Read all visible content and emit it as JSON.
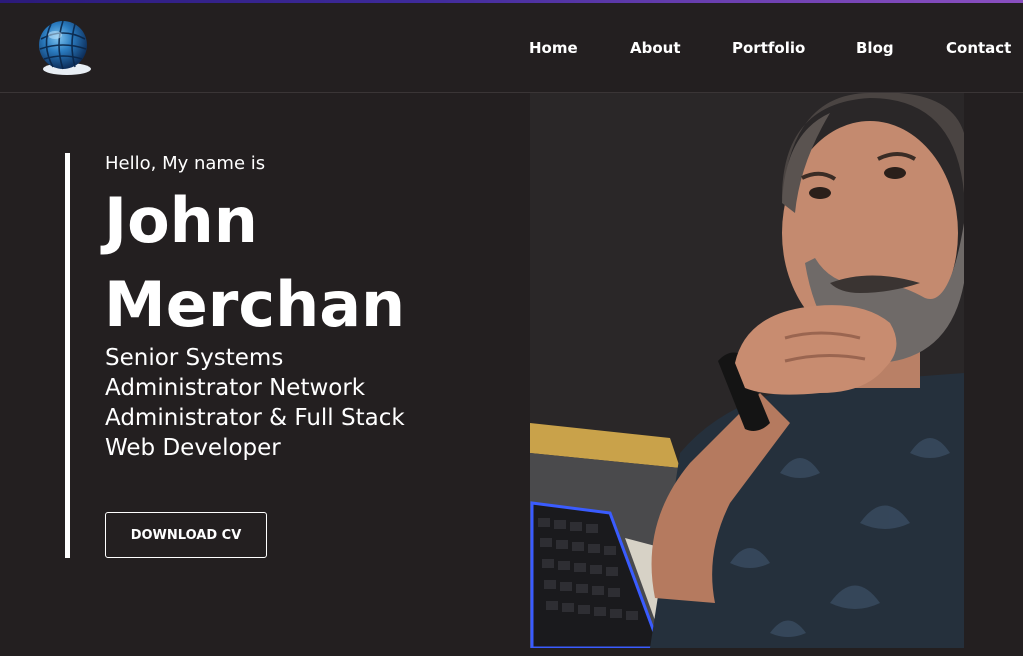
{
  "nav": {
    "items": [
      {
        "label": "Home"
      },
      {
        "label": "About"
      },
      {
        "label": "Portfolio"
      },
      {
        "label": "Blog"
      },
      {
        "label": "Contact"
      }
    ]
  },
  "hero": {
    "greeting": "Hello, My name is",
    "name": "John Merchan",
    "role": "Senior Systems Administrator Network Administrator & Full Stack Web Developer",
    "cv_button": "DOWNLOAD CV"
  },
  "icons": {
    "logo": "globe-icon"
  },
  "colors": {
    "background": "#231f20",
    "text": "#ffffff",
    "accent_bar": "#3d2a9a",
    "logo_blue": "#1f6fb3"
  }
}
